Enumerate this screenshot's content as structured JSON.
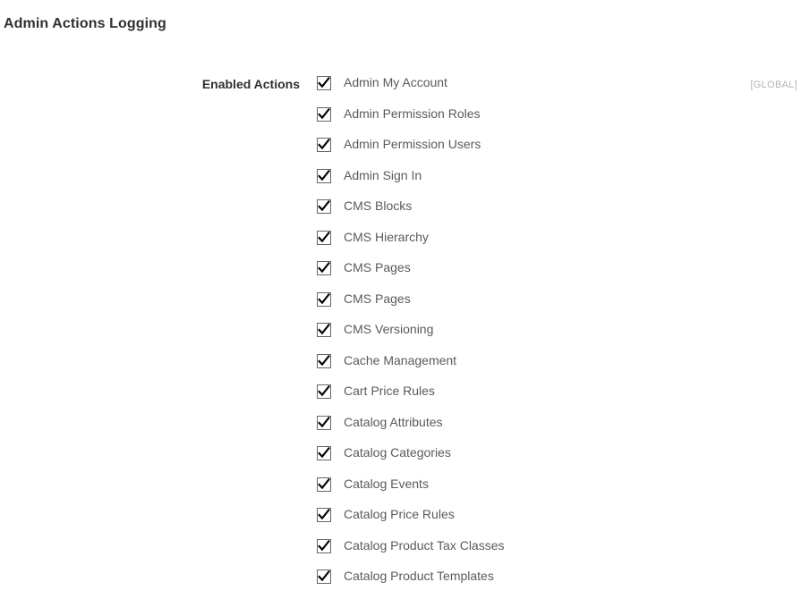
{
  "section": {
    "title": "Admin Actions Logging"
  },
  "field": {
    "label": "Enabled Actions",
    "scope": "[GLOBAL]",
    "checkbox_icon": "checkmark-icon",
    "items": [
      {
        "label": "Admin My Account",
        "checked": true
      },
      {
        "label": "Admin Permission Roles",
        "checked": true
      },
      {
        "label": "Admin Permission Users",
        "checked": true
      },
      {
        "label": "Admin Sign In",
        "checked": true
      },
      {
        "label": "CMS Blocks",
        "checked": true
      },
      {
        "label": "CMS Hierarchy",
        "checked": true
      },
      {
        "label": "CMS Pages",
        "checked": true
      },
      {
        "label": "CMS Pages",
        "checked": true
      },
      {
        "label": "CMS Versioning",
        "checked": true
      },
      {
        "label": "Cache Management",
        "checked": true
      },
      {
        "label": "Cart Price Rules",
        "checked": true
      },
      {
        "label": "Catalog Attributes",
        "checked": true
      },
      {
        "label": "Catalog Categories",
        "checked": true
      },
      {
        "label": "Catalog Events",
        "checked": true
      },
      {
        "label": "Catalog Price Rules",
        "checked": true
      },
      {
        "label": "Catalog Product Tax Classes",
        "checked": true
      },
      {
        "label": "Catalog Product Templates",
        "checked": true
      }
    ]
  },
  "colors": {
    "title_text": "#303030",
    "label_text": "#5a5a5a",
    "scope_text": "#b3b3b3",
    "checkbox_border": "#666666",
    "checkmark": "#000000",
    "background": "#ffffff"
  }
}
